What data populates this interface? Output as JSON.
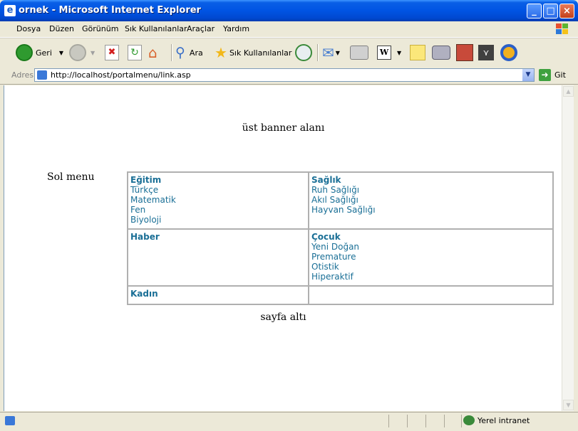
{
  "window": {
    "title": "ornek - Microsoft Internet Explorer"
  },
  "menu": [
    "Dosya",
    "Düzen",
    "Görünüm",
    "Sık Kullanılanlar",
    "Araçlar",
    "Yardım"
  ],
  "toolbar": {
    "back_label": "Geri",
    "search_label": "Ara",
    "favorites_label": "Sık Kullanılanlar"
  },
  "address": {
    "label": "Adres",
    "url": "http://localhost/portalmenu/link.asp",
    "go_label": "Git"
  },
  "page": {
    "banner": "üst banner alanı",
    "left_menu": "Sol menu",
    "footer": "sayfa altı",
    "cells": [
      {
        "category": "Eğitim",
        "links": [
          "Türkçe",
          "Matematik",
          "Fen",
          "Biyoloji"
        ]
      },
      {
        "category": "Sağlık",
        "links": [
          "Ruh Sağlığı",
          "Akıl Sağlığı",
          "Hayvan Sağlığı"
        ]
      },
      {
        "category": "Haber",
        "links": []
      },
      {
        "category": "Çocuk",
        "links": [
          "Yeni Doğan",
          "Premature",
          "Otistik",
          "Hiperaktif"
        ]
      },
      {
        "category": "Kadın",
        "links": []
      },
      {
        "category": "",
        "links": []
      }
    ]
  },
  "status": {
    "zone": "Yerel intranet"
  },
  "colors": {
    "titlebar": "#0054e3",
    "link": "#1a6f96",
    "chrome": "#ece9d8"
  }
}
